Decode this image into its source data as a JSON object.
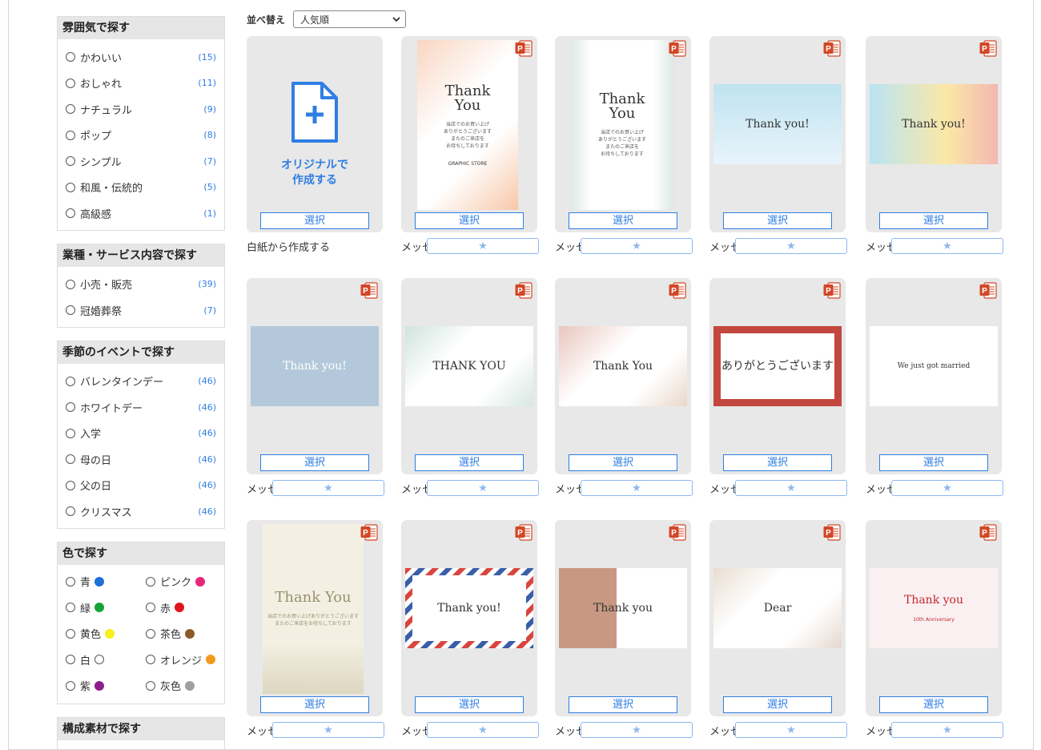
{
  "filters": {
    "mood": {
      "title": "雰囲気で探す",
      "items": [
        {
          "label": "かわいい",
          "count": "(15)"
        },
        {
          "label": "おしゃれ",
          "count": "(11)"
        },
        {
          "label": "ナチュラル",
          "count": "(9)"
        },
        {
          "label": "ポップ",
          "count": "(8)"
        },
        {
          "label": "シンプル",
          "count": "(7)"
        },
        {
          "label": "和風・伝統的",
          "count": "(5)"
        },
        {
          "label": "高級感",
          "count": "(1)"
        }
      ]
    },
    "industry": {
      "title": "業種・サービス内容で探す",
      "items": [
        {
          "label": "小売・販売",
          "count": "(39)"
        },
        {
          "label": "冠婚葬祭",
          "count": "(7)"
        }
      ]
    },
    "season": {
      "title": "季節のイベントで探す",
      "items": [
        {
          "label": "バレンタインデー",
          "count": "(46)"
        },
        {
          "label": "ホワイトデー",
          "count": "(46)"
        },
        {
          "label": "入学",
          "count": "(46)"
        },
        {
          "label": "母の日",
          "count": "(46)"
        },
        {
          "label": "父の日",
          "count": "(46)"
        },
        {
          "label": "クリスマス",
          "count": "(46)"
        }
      ]
    },
    "color": {
      "title": "色で探す",
      "items": [
        {
          "label": "青",
          "color": "#1e6fd9"
        },
        {
          "label": "ピンク",
          "color": "#e8267a"
        },
        {
          "label": "緑",
          "color": "#18a23a"
        },
        {
          "label": "赤",
          "color": "#e0141e"
        },
        {
          "label": "黄色",
          "color": "#f7f01c"
        },
        {
          "label": "茶色",
          "color": "#8b5a2b"
        },
        {
          "label": "白",
          "color": "#ffffff"
        },
        {
          "label": "オレンジ",
          "color": "#f39a1e"
        },
        {
          "label": "紫",
          "color": "#8e1e8e"
        },
        {
          "label": "灰色",
          "color": "#a0a0a0"
        }
      ]
    },
    "material": {
      "title": "構成素材で探す"
    }
  },
  "sort": {
    "label": "並べ替え",
    "value": "人気順"
  },
  "select_label": "選択",
  "new_doc": {
    "line1": "オリジナルで",
    "line2": "作成する",
    "caption": "白紙から作成する"
  },
  "cards": [
    {
      "caption": "メッセージカード_小…",
      "text": "Thank\nYou",
      "sub": "当店でのお買い上げ\nありがとうございます\nまたのご来店を\nお待ちしております",
      "footer": "GRAPHIC STORE"
    },
    {
      "caption": "メッセージカード_小…",
      "text": "Thank\nYou",
      "sub": "当店でのお買い上げ\nありがとうございます\nまたのご来店を\nお待ちしております"
    },
    {
      "caption": "メッセージカード_小…",
      "text": "Thank you!"
    },
    {
      "caption": "メッセージカード_小…",
      "text": "Thank you!"
    },
    {
      "caption": "メッセージカード_小…",
      "text": "Thank you!"
    },
    {
      "caption": "メッセージカード_小…",
      "text": "THANK YOU"
    },
    {
      "caption": "メッセージカード_小…",
      "text": "Thank You"
    },
    {
      "caption": "メッセージカード_小…",
      "text": "ありがとうございます"
    },
    {
      "caption": "メッセージカード_シ…",
      "text": "We just got married"
    },
    {
      "caption": "メッセージカード_小…",
      "text": "Thank You",
      "sub": "当店でのお買い上げありがとうございます\nまたのご来店をお待ちしております"
    },
    {
      "caption": "メッセージカード_小…",
      "text": "Thank you!"
    },
    {
      "caption": "メッセージカード_小…",
      "text": "Thank you"
    },
    {
      "caption": "メッセージカード_小…",
      "text": "Dear"
    },
    {
      "caption": "メッセージカード_小…",
      "text": "Thank you",
      "footer": "10th Anniversary"
    }
  ]
}
